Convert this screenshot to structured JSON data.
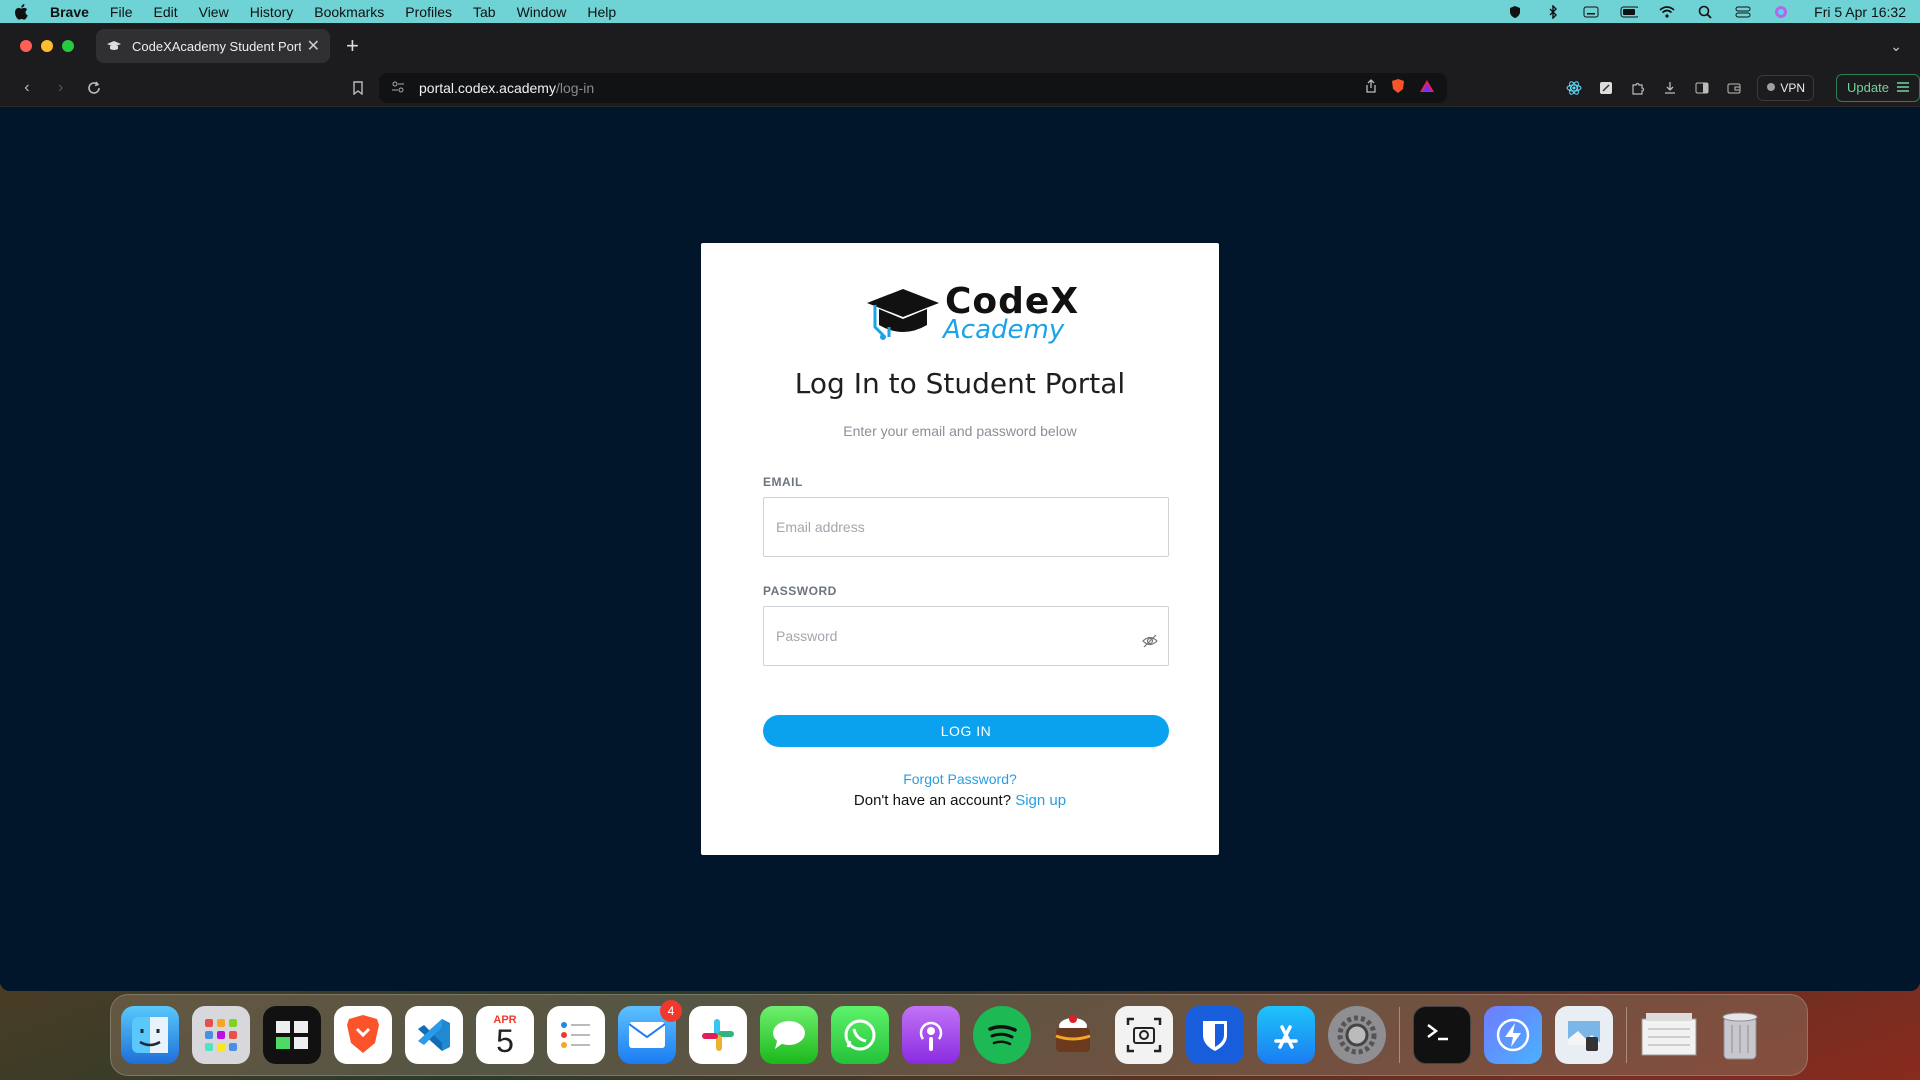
{
  "menubar": {
    "app": "Brave",
    "items": [
      "File",
      "Edit",
      "View",
      "History",
      "Bookmarks",
      "Profiles",
      "Tab",
      "Window",
      "Help"
    ],
    "clock": "Fri 5 Apr  16:32"
  },
  "browser": {
    "tab_title": "CodeXAcademy Student Porta",
    "url_host": "portal.codex.academy",
    "url_path": "/log-in",
    "vpn_label": "VPN",
    "update_label": "Update"
  },
  "login": {
    "logo_line1": "CodeX",
    "logo_line2": "Academy",
    "title": "Log In to Student Portal",
    "subtitle": "Enter your email and password below",
    "email_label": "EMAIL",
    "email_placeholder": "Email address",
    "password_label": "PASSWORD",
    "password_placeholder": "Password",
    "login_button": "LOG IN",
    "forgot_link": "Forgot Password?",
    "signup_prompt": "Don't have an account?",
    "signup_link": "Sign up"
  },
  "dock": {
    "calendar_month": "APR",
    "calendar_day": "5",
    "mail_badge": "4",
    "apps": [
      "finder-icon",
      "launchpad-icon",
      "app-icon",
      "brave-icon",
      "vscode-icon",
      "calendar-icon",
      "reminders-icon",
      "mail-icon",
      "slack-icon",
      "messages-icon",
      "whatsapp-icon",
      "podcasts-icon",
      "spotify-icon",
      "cake-icon",
      "screenshot-icon",
      "bitwarden-icon",
      "appstore-icon",
      "settings-icon",
      "terminal-icon",
      "shortcut-icon",
      "preview-icon",
      "files-icon",
      "trash-icon"
    ]
  }
}
